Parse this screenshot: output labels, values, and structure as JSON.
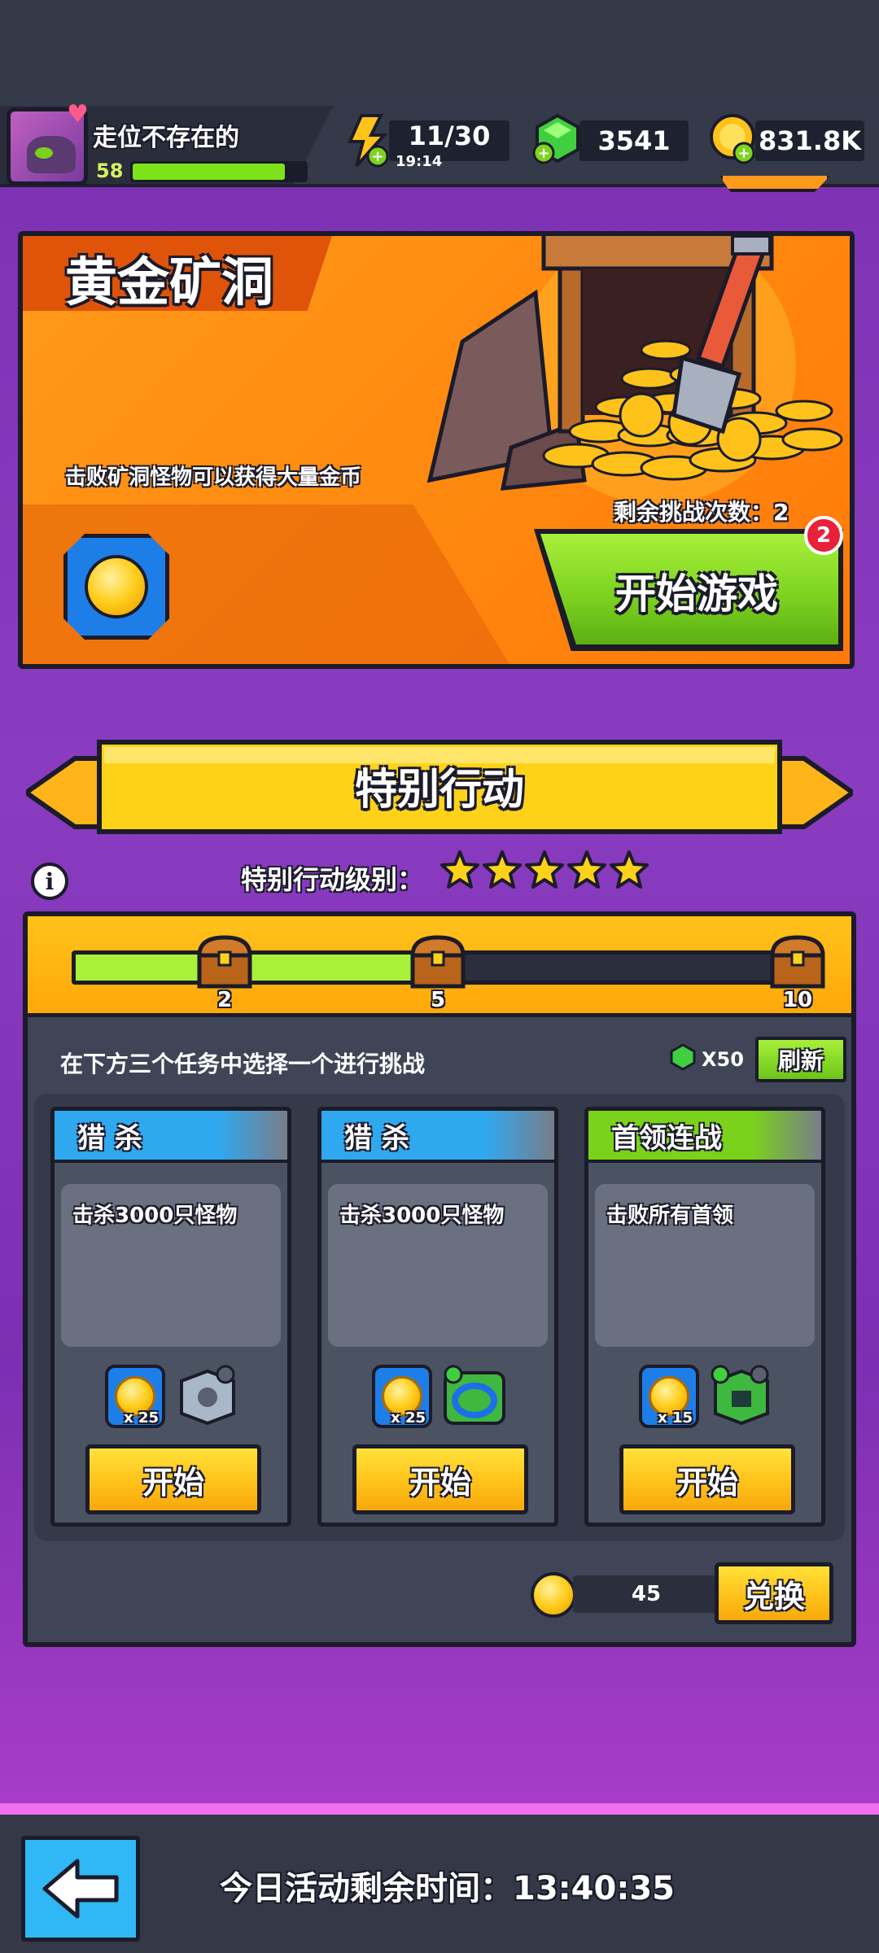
{
  "header": {
    "player_name": "走位不存在的",
    "player_level": "58",
    "energy": "11/30",
    "energy_timer": "19:14",
    "gems": "3541",
    "coins": "831.8K"
  },
  "gold_mine": {
    "title": "黄金矿洞",
    "description": "击败矿洞怪物可以获得大量金币",
    "remaining_label": "剩余挑战次数：2",
    "start_button": "开始游戏",
    "badge_count": "2"
  },
  "special_action": {
    "banner_title": "特别行动",
    "level_label": "特别行动级别：",
    "stars": 5,
    "progress": {
      "milestones": [
        "2",
        "5",
        "10"
      ],
      "fill_fraction": 0.5
    },
    "instruction": "在下方三个任务中选择一个进行挑战",
    "refresh_cost": "X50",
    "refresh_button": "刷新",
    "tasks": [
      {
        "type": "猎 杀",
        "desc": "击杀3000只怪物",
        "coin_qty": "x 25",
        "start": "开始",
        "color": "#2fa8f0"
      },
      {
        "type": "猎 杀",
        "desc": "击杀3000只怪物",
        "coin_qty": "x 25",
        "start": "开始",
        "color": "#2fa8f0"
      },
      {
        "type": "首领连战",
        "desc": "击败所有首领",
        "coin_qty": "x 15",
        "start": "开始",
        "color": "#7ad21a"
      }
    ],
    "token_count": "45",
    "exchange_button": "兑换"
  },
  "footer": {
    "time_label": "今日活动剩余时间：13:40:35"
  },
  "icons": [
    "avatar",
    "heart-icon",
    "energy-icon",
    "gem-icon",
    "coin-icon",
    "info-icon",
    "star-icon",
    "chest-icon",
    "back-arrow-icon"
  ]
}
